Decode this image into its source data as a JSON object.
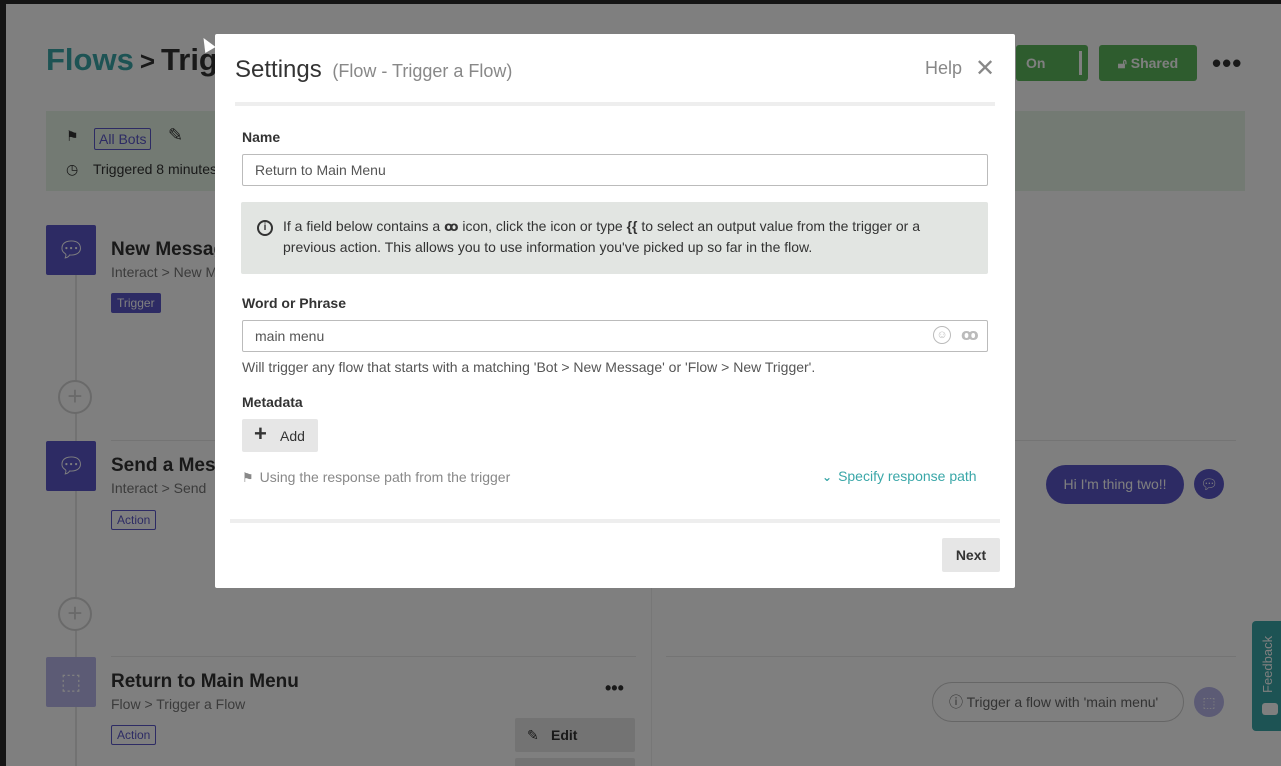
{
  "page": {
    "breadcrumb_root": "Flows",
    "breadcrumb_sep": ">",
    "breadcrumb_current": "Trigg",
    "toggle_label": "On",
    "shared_label": "Shared",
    "more_label": "•••",
    "bots_badge": "All Bots",
    "triggered_text": "Triggered 8 minutes"
  },
  "steps": [
    {
      "title": "New Messag",
      "subtitle": "Interact > New M",
      "tag": "Trigger"
    },
    {
      "title": "Send a Mess",
      "subtitle": "Interact > Send",
      "tag": "Action"
    },
    {
      "title": "Return to Main Menu",
      "subtitle": "Flow > Trigger a Flow",
      "tag": "Action"
    }
  ],
  "step_actions": {
    "edit_label": "Edit",
    "more_label": "•••"
  },
  "preview": {
    "bot_bubble": "Hi I'm thing two!!",
    "flow_bubble": "Trigger a flow with 'main menu'"
  },
  "feedback": {
    "label": "Feedback"
  },
  "modal": {
    "title": "Settings",
    "subtitle": "(Flow - Trigger a Flow)",
    "help_label": "Help",
    "close_label": "✕",
    "name_label": "Name",
    "name_value": "Return to Main Menu",
    "info_text_1": "If a field below contains a",
    "info_text_2": "icon, click the icon or type",
    "info_token": "{{",
    "info_text_3": "to select an output value from the trigger or a previous action. This allows you to use information you've picked up so far in the flow.",
    "phrase_label": "Word or Phrase",
    "phrase_value": "main menu",
    "phrase_help": "Will trigger any flow that starts with a matching 'Bot > New Message' or 'Flow > New Trigger'.",
    "metadata_label": "Metadata",
    "add_label": "Add",
    "response_path_text": "Using the response path from the trigger",
    "specify_label": "Specify response path",
    "next_label": "Next"
  },
  "colors": {
    "teal": "#3aa7a8",
    "purple": "#5b57c9",
    "green": "#5cb85c"
  }
}
